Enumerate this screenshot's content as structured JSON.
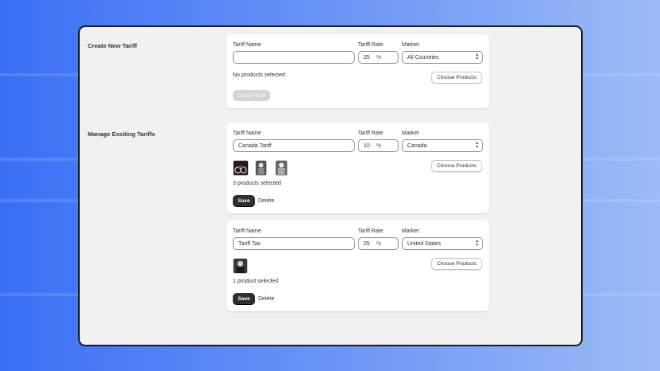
{
  "create_section": {
    "title": "Create New Tariff",
    "tariff_name_label": "Tariff Name",
    "tariff_name_value": "",
    "tariff_rate_label": "Tariff Rate",
    "tariff_rate_value": "25",
    "rate_suffix": "%",
    "market_label": "Market",
    "market_value": "All Countries",
    "products_text": "No products selected",
    "choose_products_label": "Choose Products",
    "create_button_label": "Create Tariff"
  },
  "manage_section": {
    "title": "Manage Exsiting Tariffs",
    "tariffs": [
      {
        "tariff_name_label": "Tariff Name",
        "tariff_name_value": "Canada Tariff",
        "tariff_rate_label": "Tariff Rate",
        "tariff_rate_value": "10",
        "rate_suffix": "%",
        "market_label": "Market",
        "market_value": "Canada",
        "choose_products_label": "Choose Products",
        "products_text": "3 products selected",
        "save_label": "Save",
        "delete_label": "Delete"
      },
      {
        "tariff_name_label": "Tariff Name",
        "tariff_name_value": "Tariff Tax",
        "tariff_rate_label": "Tariff Rate",
        "tariff_rate_value": "25",
        "rate_suffix": "%",
        "market_label": "Market",
        "market_value": "United States",
        "choose_products_label": "Choose Products",
        "products_text": "1 product selected",
        "save_label": "Save",
        "delete_label": "Delete"
      }
    ]
  },
  "icons": {
    "select_chevron": "chevron-up-down-icon",
    "product_thumbnail": "product-image"
  },
  "colors": {
    "background_gradient_start": "#3a6ff5",
    "background_gradient_end": "#9dbbf6",
    "window_bg": "#f1f1f1",
    "primary_button": "#303030",
    "disabled_button": "#d4d4d4"
  }
}
